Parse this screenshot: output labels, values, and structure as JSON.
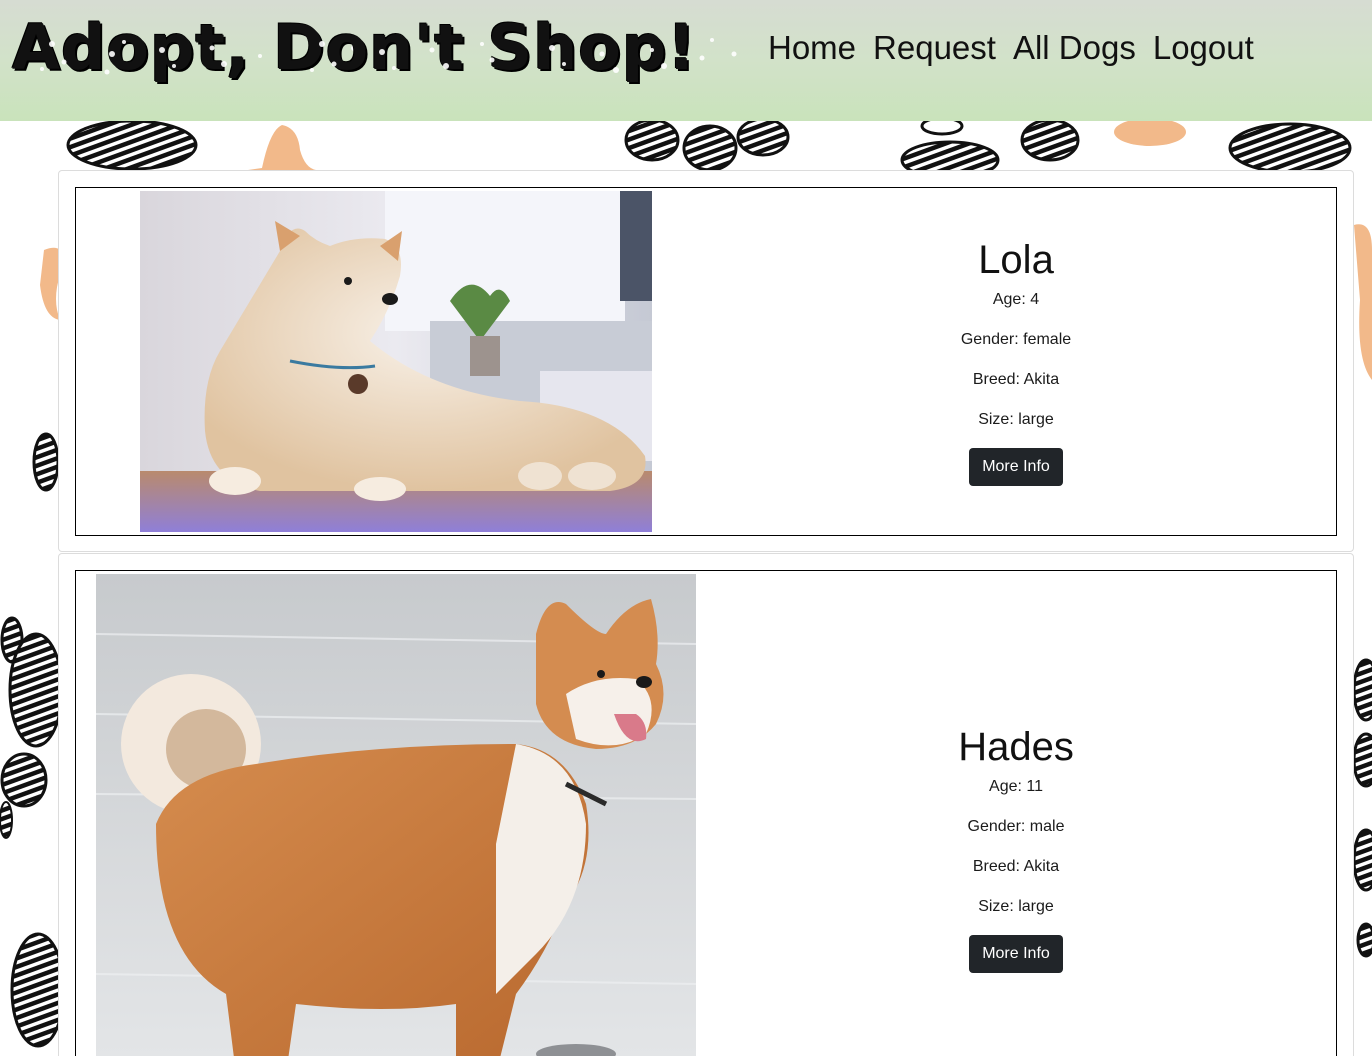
{
  "brand": {
    "title": "Adopt, Don't Shop!"
  },
  "nav": {
    "items": [
      {
        "label": "Home"
      },
      {
        "label": "Request"
      },
      {
        "label": "All Dogs"
      },
      {
        "label": "Logout"
      }
    ]
  },
  "dogs": [
    {
      "name": "Lola",
      "age": "Age: 4",
      "gender": "Gender: female",
      "breed": "Breed: Akita",
      "size": "Size: large",
      "button": "More Info"
    },
    {
      "name": "Hades",
      "age": "Age: 11",
      "gender": "Gender: male",
      "breed": "Breed: Akita",
      "size": "Size: large",
      "button": "More Info"
    }
  ],
  "colors": {
    "header_top": "#d6dcd2",
    "header_bottom": "#c9e3bb",
    "button": "#212529",
    "paw_black": "#111111",
    "paw_orange": "#f2b98a"
  }
}
